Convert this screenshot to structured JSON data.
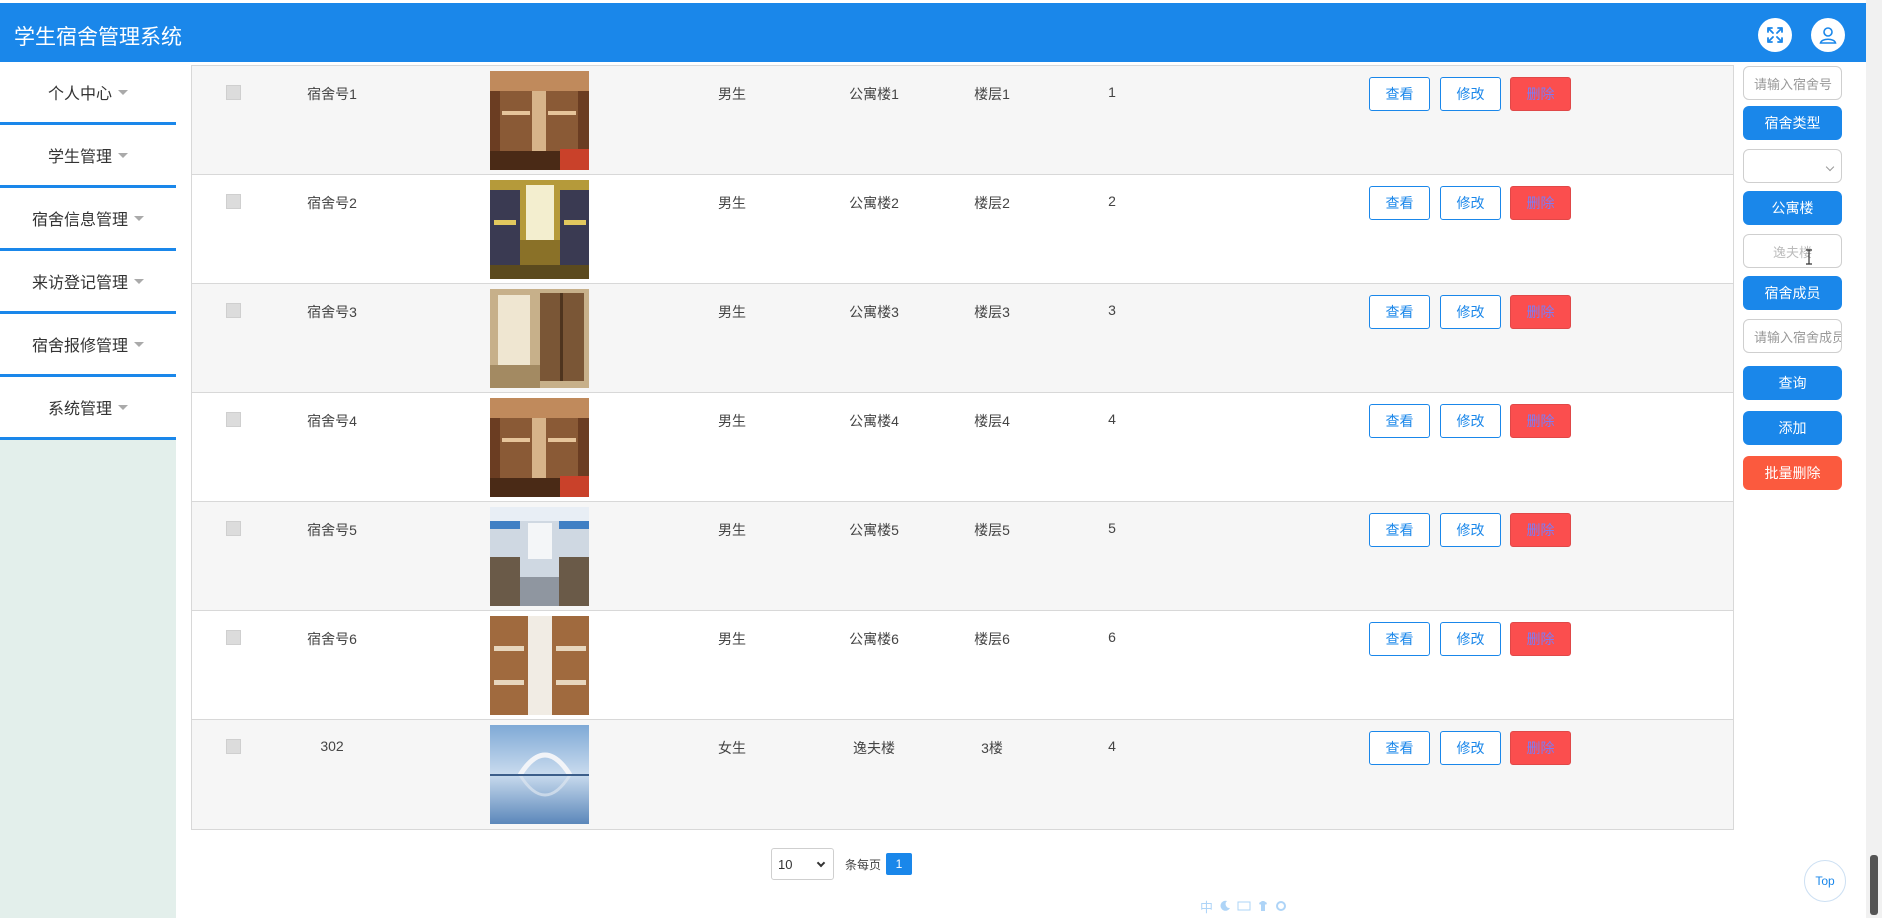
{
  "header": {
    "title": "学生宿舍管理系统",
    "fullscreen_icon": "expand-icon",
    "user_icon": "user-icon"
  },
  "sidebar": {
    "items": [
      {
        "label": "个人中心"
      },
      {
        "label": "学生管理"
      },
      {
        "label": "宿舍信息管理"
      },
      {
        "label": "来访登记管理"
      },
      {
        "label": "宿舍报修管理"
      },
      {
        "label": "系统管理"
      }
    ]
  },
  "table": {
    "actions": {
      "view": "查看",
      "edit": "修改",
      "delete": "删除"
    },
    "rows": [
      {
        "number": "宿舍号1",
        "sex": "男生",
        "building": "公寓楼1",
        "floor": "楼层1",
        "capacity": "1",
        "photo": "dorm-bunk-warm"
      },
      {
        "number": "宿舍号2",
        "sex": "男生",
        "building": "公寓楼2",
        "floor": "楼层2",
        "capacity": "2",
        "photo": "dorm-yellow-room"
      },
      {
        "number": "宿舍号3",
        "sex": "男生",
        "building": "公寓楼3",
        "floor": "楼层3",
        "capacity": "3",
        "photo": "dorm-wardrobe"
      },
      {
        "number": "宿舍号4",
        "sex": "男生",
        "building": "公寓楼4",
        "floor": "楼层4",
        "capacity": "4",
        "photo": "dorm-bunk-warm"
      },
      {
        "number": "宿舍号5",
        "sex": "男生",
        "building": "公寓楼5",
        "floor": "楼层5",
        "capacity": "5",
        "photo": "dorm-blue-corridor"
      },
      {
        "number": "宿舍号6",
        "sex": "男生",
        "building": "公寓楼6",
        "floor": "楼层6",
        "capacity": "6",
        "photo": "dorm-long-room"
      },
      {
        "number": "302",
        "sex": "女生",
        "building": "逸夫楼",
        "floor": "3楼",
        "capacity": "4",
        "photo": "bridge-lake"
      }
    ]
  },
  "filters": {
    "number_placeholder": "请输入宿舍号",
    "type_label": "宿舍类型",
    "building_label": "公寓楼",
    "building_value": "逸夫楼",
    "members_label": "宿舍成员",
    "members_placeholder": "请输入宿舍成员",
    "search_label": "查询",
    "add_label": "添加",
    "batch_delete_label": "批量删除"
  },
  "pagination": {
    "page_size": "10",
    "per_page_label": "条每页",
    "current_page": "1"
  },
  "top_button": "Top",
  "ime_bar": [
    "中"
  ],
  "colors": {
    "primary": "#1a87ea",
    "danger": "#fb4e4e",
    "sidebar_bg": "#e3efeb"
  }
}
